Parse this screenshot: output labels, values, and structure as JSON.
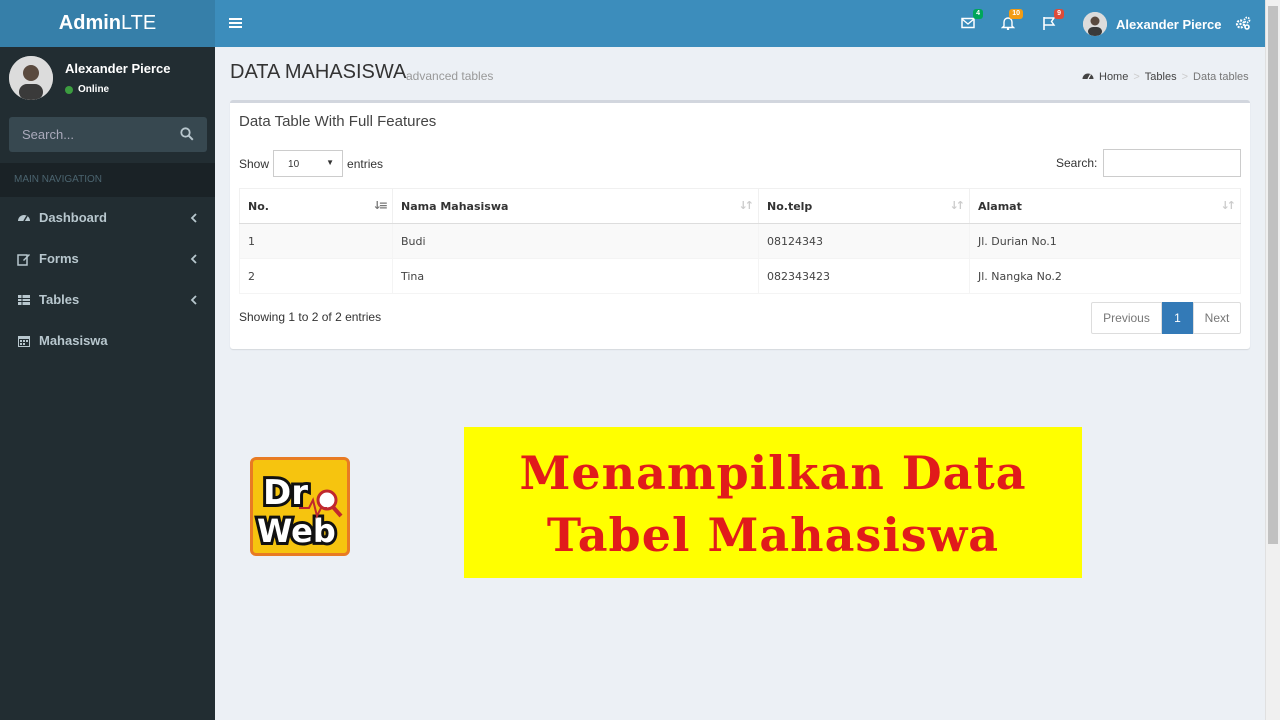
{
  "app": {
    "logo_bold": "Admin",
    "logo_rest": "LTE"
  },
  "sidebar": {
    "user_name": "Alexander Pierce",
    "user_status": "Online",
    "search_placeholder": "Search...",
    "nav_header": "MAIN NAVIGATION",
    "items": [
      {
        "label": "Dashboard",
        "icon": "dashboard-icon",
        "has_chevron": true
      },
      {
        "label": "Forms",
        "icon": "edit-icon",
        "has_chevron": true
      },
      {
        "label": "Tables",
        "icon": "table-icon",
        "has_chevron": true
      },
      {
        "label": "Mahasiswa",
        "icon": "calendar-icon",
        "has_chevron": false
      }
    ]
  },
  "topbar": {
    "messages_count": "4",
    "notifications_count": "10",
    "tasks_count": "9",
    "user_name": "Alexander Pierce",
    "colors": {
      "messages": "#00a65a",
      "notifications": "#f39c12",
      "tasks": "#dd4b39"
    }
  },
  "content": {
    "title": "DATA MAHASISWA",
    "subtitle": "advanced tables",
    "breadcrumb": [
      "Home",
      "Tables",
      "Data tables"
    ]
  },
  "box": {
    "title": "Data Table With Full Features",
    "show_label": "Show",
    "entries_value": "10",
    "entries_label": "entries",
    "search_label": "Search:",
    "columns": [
      "No.",
      "Nama Mahasiswa",
      "No.telp",
      "Alamat"
    ],
    "rows": [
      [
        "1",
        "Budi",
        "08124343",
        "Jl. Durian No.1"
      ],
      [
        "2",
        "Tina",
        "082343423",
        "Jl. Nangka No.2"
      ]
    ],
    "info": "Showing 1 to 2 of 2 entries",
    "pager": {
      "previous": "Previous",
      "current": "1",
      "next": "Next"
    }
  },
  "overlay": {
    "banner_line1": "Menampilkan Data",
    "banner_line2": "Tabel Mahasiswa",
    "logo_text_top": "Dr",
    "logo_text_bottom": "Web"
  }
}
